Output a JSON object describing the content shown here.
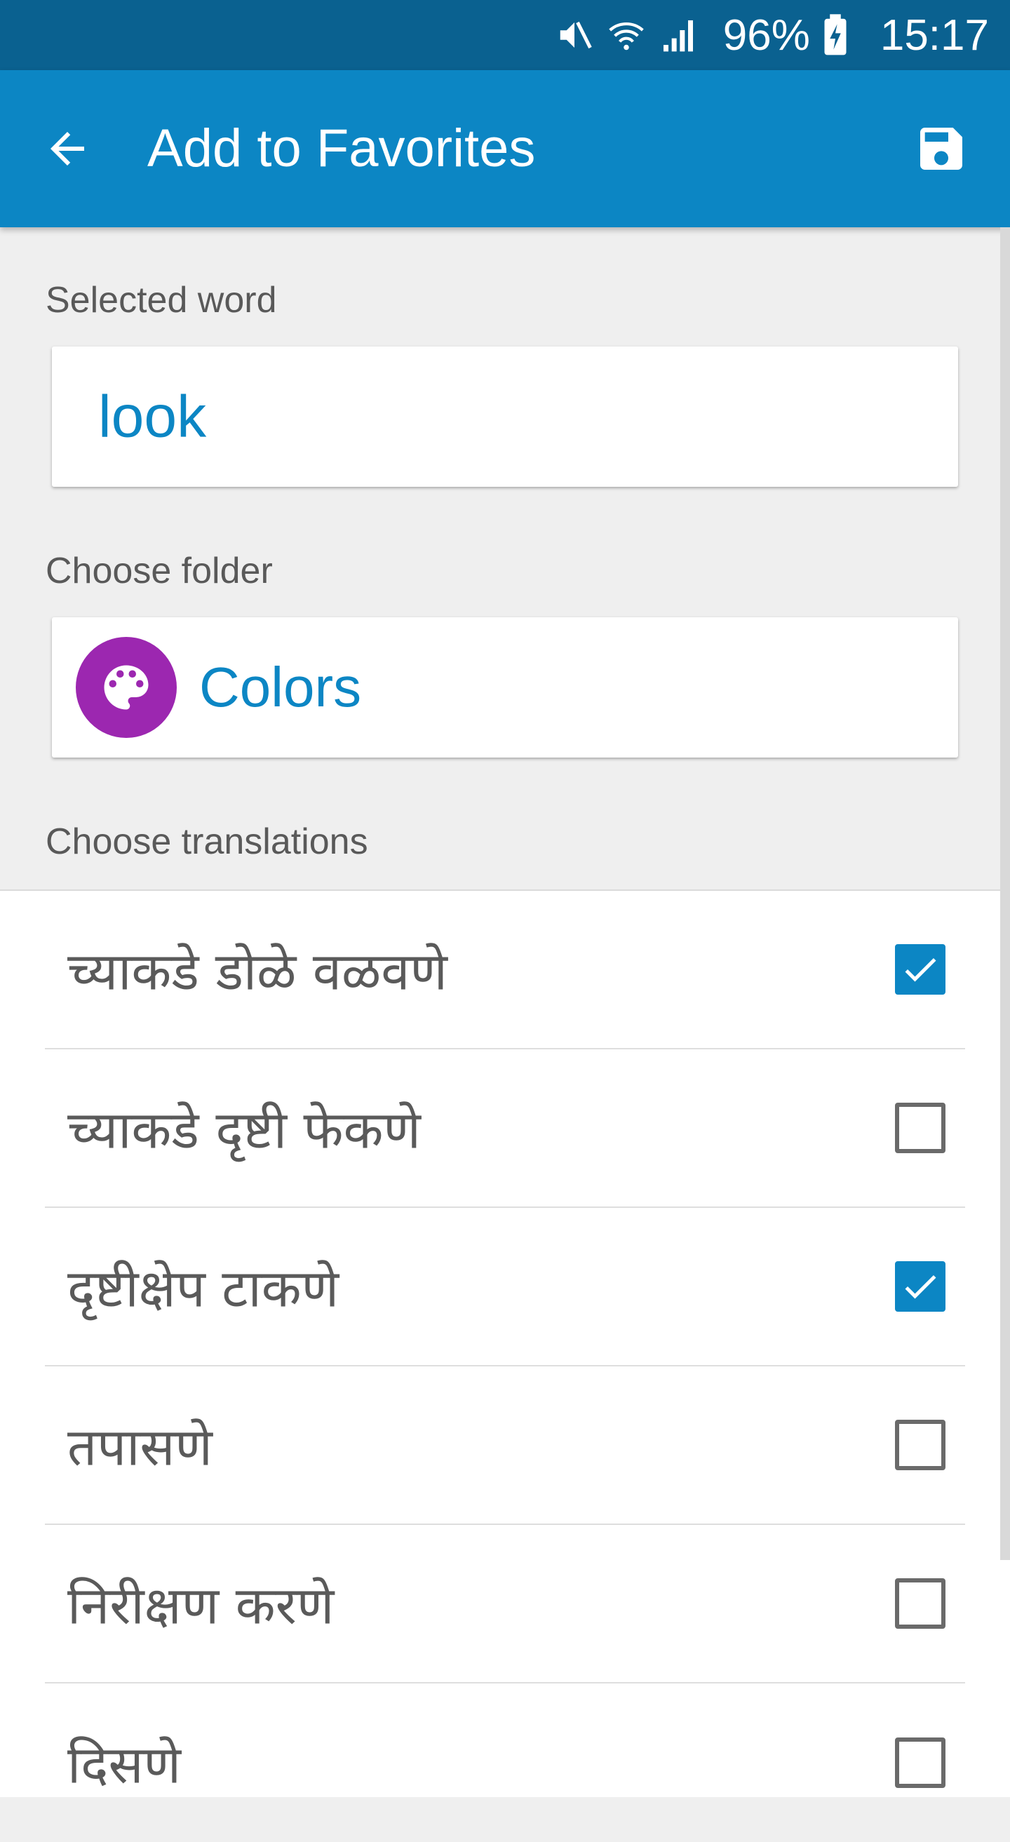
{
  "status_bar": {
    "battery": "96%",
    "time": "15:17",
    "icons": [
      "mute-icon",
      "wifi-icon",
      "signal-icon",
      "battery-charging-icon"
    ]
  },
  "app_bar": {
    "title": "Add to Favorites",
    "back_icon": "arrow-back-icon",
    "save_icon": "save-icon"
  },
  "selected_word": {
    "label": "Selected word",
    "value": "look"
  },
  "folder": {
    "label": "Choose folder",
    "name": "Colors",
    "icon": "palette-icon",
    "icon_color": "#9c27b0"
  },
  "translations": {
    "label": "Choose translations",
    "items": [
      {
        "text": "च्याकडे डोळे वळवणे",
        "checked": true
      },
      {
        "text": "च्याकडे दृष्टी फेकणे",
        "checked": false
      },
      {
        "text": "दृष्टीक्षेप टाकणे",
        "checked": true
      },
      {
        "text": "तपासणे",
        "checked": false
      },
      {
        "text": "निरीक्षण करणे",
        "checked": false
      },
      {
        "text": "दिसणे",
        "checked": false
      }
    ]
  },
  "colors": {
    "app_bar": "#0c86c4",
    "status_bar": "#0a6190",
    "accent": "#0c86c4"
  }
}
